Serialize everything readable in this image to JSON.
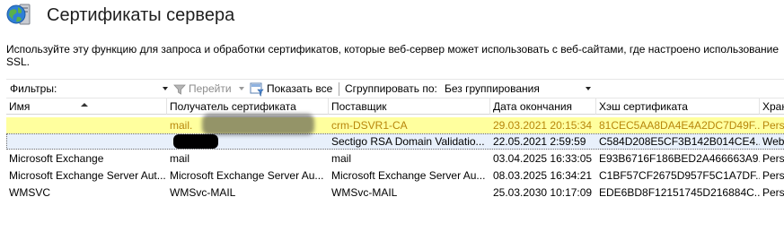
{
  "header": {
    "title": "Сертификаты сервера",
    "icon": "globe-server-icon"
  },
  "description": "Используйте эту функцию для запроса и обработки сертификатов, которые веб-сервер может использовать с веб-сайтами, где настроено использование SSL.",
  "toolbar": {
    "filter_label": "Фильтры:",
    "filter_value": "",
    "go_label": "Перейти",
    "show_all_label": "Показать все",
    "group_by_label": "Сгруппировать по:",
    "group_by_value": "Без группирования"
  },
  "grid": {
    "columns": [
      "Имя",
      "Получатель сертификата",
      "Поставщик",
      "Дата окончания",
      "Хэш сертификата",
      "Хран"
    ],
    "rows": [
      {
        "cells": [
          "",
          "mail.",
          "crm-DSVR1-CA",
          "29.03.2021 20:15:34",
          "81CEC5AA8DA4E4A2DC7D49F...",
          "Pers"
        ],
        "state": "highlighted"
      },
      {
        "cells": [
          "",
          "",
          "Sectigo RSA Domain Validatio...",
          "22.05.2021 2:59:59",
          "C584D208E5CF3B142B014CE4...",
          "Web"
        ],
        "state": "selected"
      },
      {
        "cells": [
          "Microsoft Exchange",
          "mail",
          "mail",
          "03.04.2025 16:33:05",
          "E93B6716F186BED2A466663A9...",
          "Pers"
        ],
        "state": "normal"
      },
      {
        "cells": [
          "Microsoft Exchange Server Aut...",
          "Microsoft Exchange Server Au...",
          "Microsoft Exchange Server Au...",
          "08.03.2025 16:34:21",
          "C1BF57CF2675D957F5C1A7DF...",
          "Pers"
        ],
        "state": "normal"
      },
      {
        "cells": [
          "WMSVC",
          "WMSvc-MAIL",
          "WMSvc-MAIL",
          "25.03.2030 10:17:09",
          "EDE6BD8F12151745D216884C...",
          "Pers"
        ],
        "state": "normal"
      }
    ]
  },
  "colors": {
    "highlight_row_bg": "#ffff9e",
    "highlight_row_text": "#b8860b",
    "selected_row_bg": "#e8f0fb"
  }
}
